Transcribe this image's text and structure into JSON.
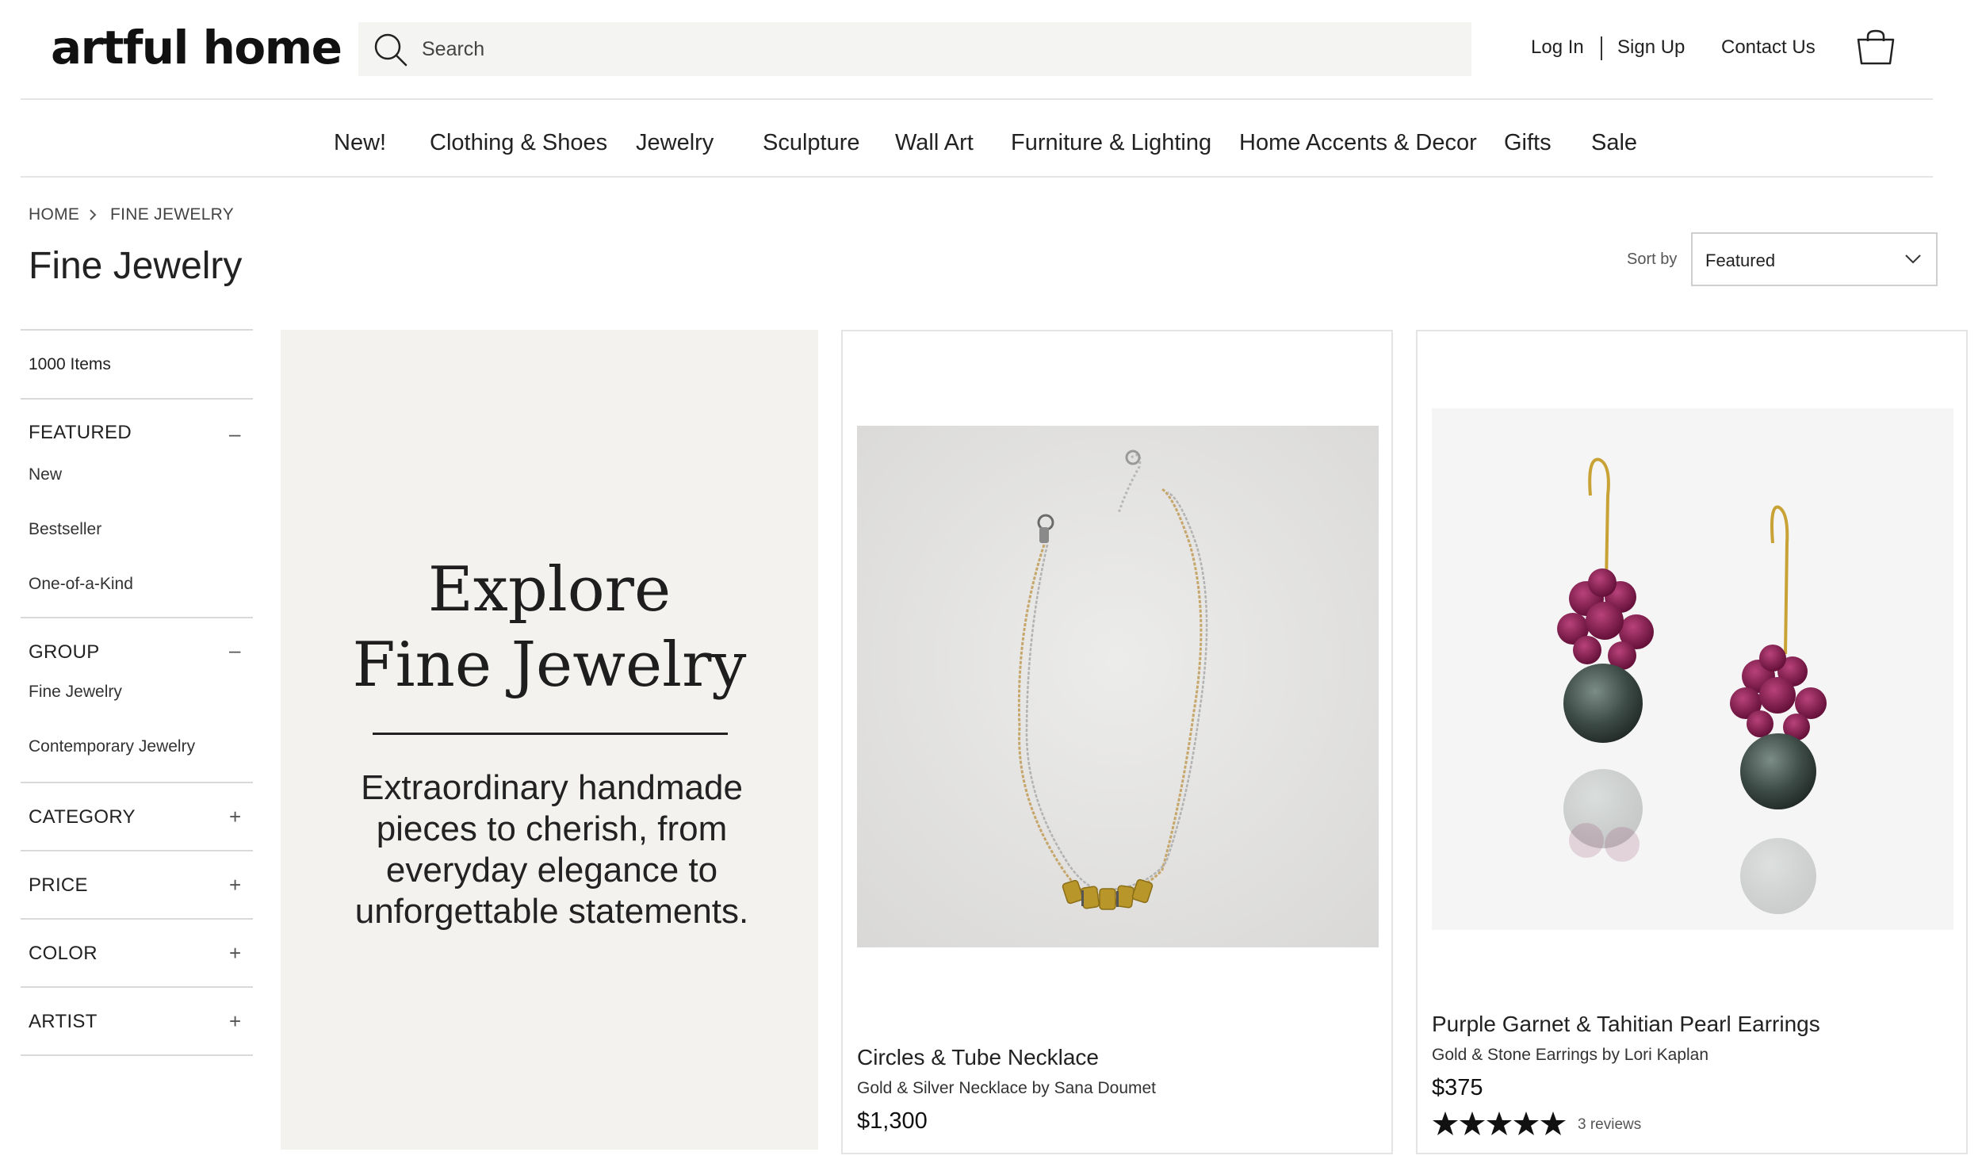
{
  "header": {
    "logo": "artful home",
    "search_placeholder": "Search",
    "login": "Log In",
    "signup": "Sign Up",
    "contact": "Contact Us"
  },
  "nav": [
    "New!",
    "Clothing & Shoes",
    "Jewelry",
    "Sculpture",
    "Wall Art",
    "Furniture & Lighting",
    "Home Accents & Decor",
    "Gifts",
    "Sale"
  ],
  "breadcrumb": [
    "HOME",
    "FINE JEWELRY"
  ],
  "page_title": "Fine Jewelry",
  "sort": {
    "label": "Sort by",
    "value": "Featured"
  },
  "sidebar": {
    "count": "1000 Items",
    "featured": {
      "title": "FEATURED",
      "toggle": "–",
      "options": [
        "New",
        "Bestseller",
        "One-of-a-Kind"
      ]
    },
    "group": {
      "title": "GROUP",
      "toggle": "–",
      "options": [
        "Fine Jewelry",
        "Contemporary Jewelry"
      ]
    },
    "category": {
      "title": "CATEGORY",
      "toggle": "+"
    },
    "price": {
      "title": "PRICE",
      "toggle": "+"
    },
    "color": {
      "title": "COLOR",
      "toggle": "+"
    },
    "artist": {
      "title": "ARTIST",
      "toggle": "+"
    }
  },
  "promo": {
    "line1": "Explore",
    "line2": "Fine Jewelry",
    "text": "Extraordinary handmade pieces to cherish, from everyday elegance to unforgettable statements."
  },
  "products": [
    {
      "name": "Circles & Tube Necklace",
      "desc": "Gold & Silver Necklace by Sana Doumet",
      "price": "$1,300"
    },
    {
      "name": "Purple Garnet & Tahitian Pearl Earrings",
      "desc": "Gold & Stone Earrings by Lori Kaplan",
      "price": "$375",
      "rating": 5,
      "reviews": "3 reviews"
    }
  ],
  "colors": {
    "promo_bg": "#f3f2ef",
    "search_bg": "#f4f4f3",
    "garnet": "#7a1445",
    "pearl": "#3c4a45"
  }
}
